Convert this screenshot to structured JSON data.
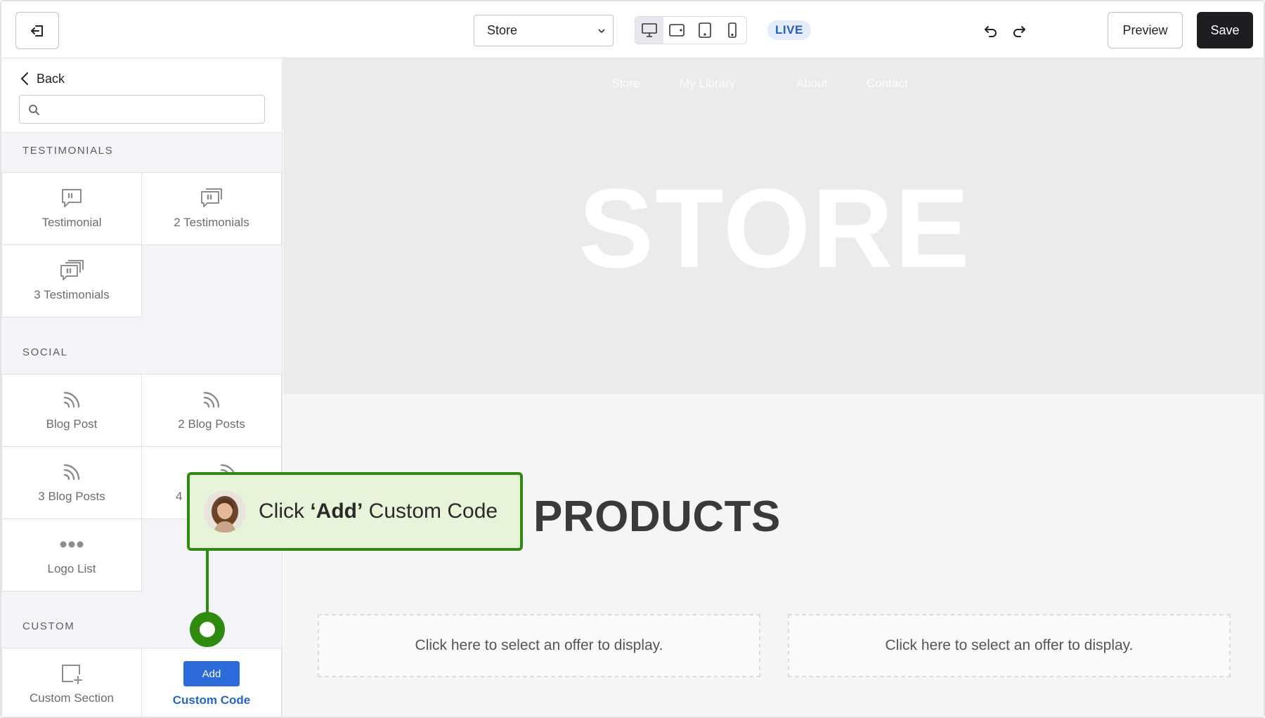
{
  "toolbar": {
    "page_select": {
      "value": "Store"
    },
    "live_label": "LIVE",
    "preview_label": "Preview",
    "save_label": "Save",
    "devices": [
      "desktop-icon",
      "tablet-landscape-icon",
      "tablet-portrait-icon",
      "mobile-icon"
    ]
  },
  "sidebar": {
    "back_label": "Back",
    "search": {
      "value": "",
      "placeholder": ""
    },
    "sections": [
      {
        "label": "TESTIMONIALS",
        "tiles": [
          "Testimonial",
          "2 Testimonials",
          "3 Testimonials"
        ]
      },
      {
        "label": "SOCIAL",
        "tiles": [
          "Blog Post",
          "2 Blog Posts",
          "3 Blog Posts",
          "4",
          "Logo List"
        ]
      },
      {
        "label": "CUSTOM",
        "tiles": [
          "Custom Section",
          "Custom Code"
        ]
      }
    ],
    "add_button_label": "Add"
  },
  "canvas": {
    "nav": [
      "Store",
      "My Library",
      "About",
      "Contact"
    ],
    "hero_title": "STORE",
    "products_title": "PRODUCTS",
    "offer_placeholder": "Click here to select an offer to display."
  },
  "callout": {
    "prefix": "Click ",
    "emphasis": "‘Add’",
    "suffix": " Custom Code",
    "accent": "#2f8a0f",
    "background": "#e8f4da"
  },
  "colors": {
    "primary_blue": "#2b6ad9",
    "save_dark": "#1d1e21",
    "live_bg": "#e3ecfb",
    "live_text": "#2a5db8"
  }
}
